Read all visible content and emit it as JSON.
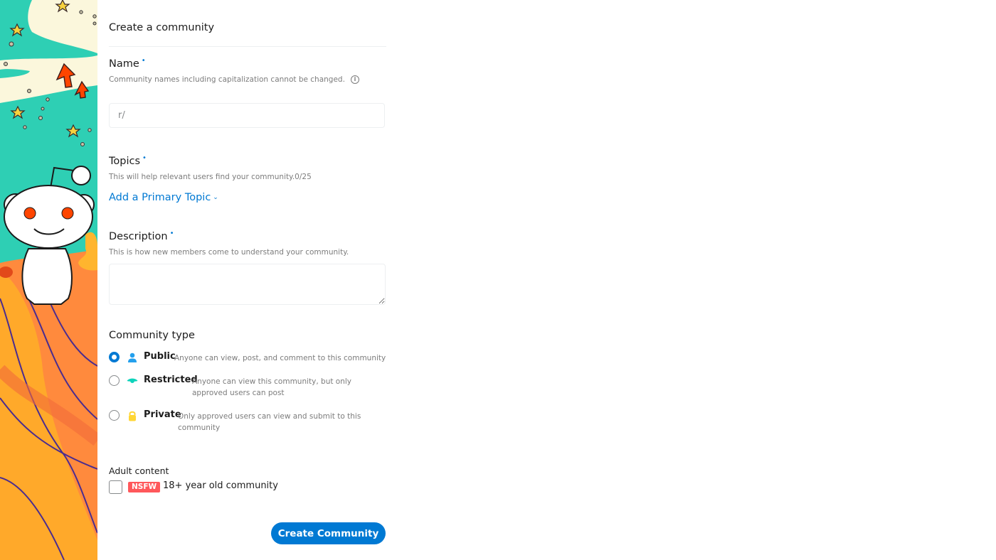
{
  "page": {
    "title": "Create a community"
  },
  "name_field": {
    "label": "Name",
    "required_mark": "•",
    "help": "Community names including capitalization cannot be changed.",
    "info_icon": "info-icon",
    "prefix": "r/",
    "value": ""
  },
  "topics_field": {
    "label": "Topics",
    "required_mark": "•",
    "help": "This will help relevant users find your community.0/25",
    "add_link": "Add a Primary Topic",
    "chevron_icon": "chevron-down-icon"
  },
  "description_field": {
    "label": "Description",
    "required_mark": "•",
    "help": "This is how new members come to understand your community.",
    "value": ""
  },
  "community_type": {
    "label": "Community type",
    "options": [
      {
        "title": "Public",
        "description": "Anyone can view, post, and comment to this community",
        "icon": "person-icon",
        "icon_color": "#24a0ed",
        "checked": true
      },
      {
        "title": "Restricted",
        "description": "Anyone can view this community, but only approved users can post",
        "icon": "eye-icon",
        "icon_color": "#0dd3bb",
        "checked": false
      },
      {
        "title": "Private",
        "description": "Only approved users can view and submit to this community",
        "icon": "lock-icon",
        "icon_color": "#ffd635",
        "checked": false
      }
    ]
  },
  "adult_content": {
    "label": "Adult content",
    "badge": "NSFW",
    "text": "18+ year old community",
    "checked": false
  },
  "actions": {
    "create_label": "Create Community"
  },
  "colors": {
    "accent": "#0079d3",
    "nsfw": "#ff585b",
    "muted_text": "#7c7c7c"
  },
  "illustration": {
    "subject": "snoo-mascot-illustration"
  }
}
